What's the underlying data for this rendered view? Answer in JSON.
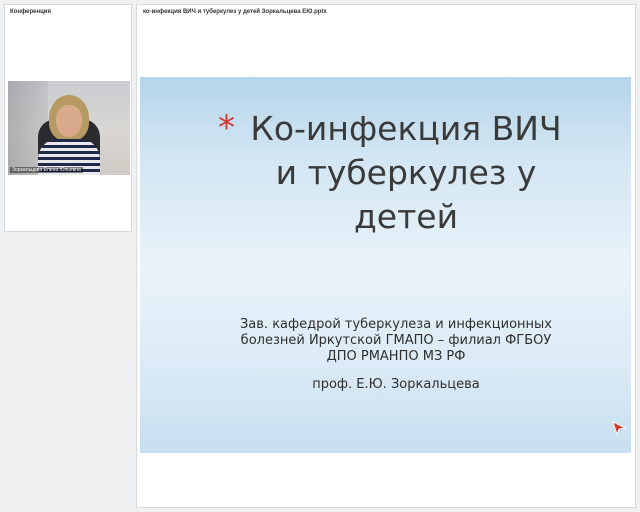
{
  "left_panel": {
    "title": "Конференция",
    "participant_name": "Зоркальцева Елена Юльевна"
  },
  "document": {
    "filename": "ко-инфекция ВИЧ и туберкулез у детей Зоркальцева ЕЮ.pptx"
  },
  "slide": {
    "bullet_symbol": "*",
    "title_lines": [
      "Ко-инфекция ВИЧ",
      "и туберкулез у",
      "детей"
    ],
    "subtitle_lines": [
      "Зав. кафедрой туберкулеза и инфекционных",
      "болезней Иркутской ГМАПО – филиал ФГБОУ",
      "ДПО РМАНПО МЗ РФ"
    ],
    "author": "проф. Е.Ю. Зоркальцева",
    "pointer_icon": "laser-pointer-icon",
    "accent_color": "#d2382c"
  }
}
